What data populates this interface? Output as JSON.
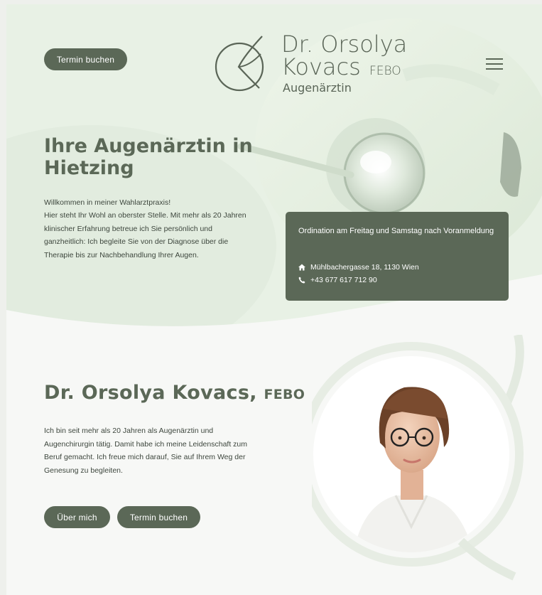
{
  "header": {
    "book_button": "Termin buchen",
    "logo_name_line1": "Dr. Orsolya",
    "logo_name_line2": "Kovacs",
    "logo_suffix": "FEBO",
    "logo_subtitle": "Augenärztin"
  },
  "hero": {
    "heading": "Ihre Augenärztin in Hietzing",
    "intro_lines": [
      "Willkommen in meiner Wahlarztpraxis!",
      "Hier steht Ihr Wohl an oberster Stelle. Mit mehr als 20 Jahren klinischer Erfahrung betreue ich Sie persönlich und ganzheitlich: Ich begleite Sie von der Diagnose über die Therapie bis zur Nachbehandlung Ihrer Augen."
    ]
  },
  "info_card": {
    "title": "Ordination am Freitag und Samstag nach Voranmeldung",
    "address": "Mühlbachergasse 18, 1130 Wien",
    "phone": "+43 677 617 712 90"
  },
  "about": {
    "heading": "Dr. Orsolya Kovacs,",
    "heading_suffix": "FEBO",
    "text": "Ich bin seit mehr als 20 Jahren als Augenärztin und Augenchirurgin tätig. Damit habe ich meine Leidenschaft zum Beruf gemacht. Ich freue mich darauf, Sie auf Ihrem Weg der Genesung zu begleiten.",
    "about_button": "Über mich",
    "book_button": "Termin buchen"
  },
  "icons": {
    "menu": "hamburger-menu-icon",
    "address": "home-icon",
    "phone": "phone-icon",
    "logo": "eye-logo-icon"
  },
  "colors": {
    "primary": "#5b6857",
    "hero_tint": "#e6efe2",
    "text": "#3d463d",
    "page_background": "#f7f8f6"
  }
}
